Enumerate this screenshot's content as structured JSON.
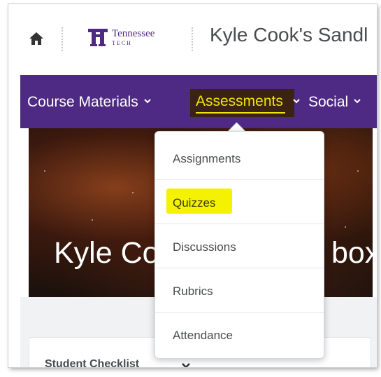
{
  "header": {
    "logo": {
      "word": "Tennessee",
      "sub": "TECH"
    },
    "course_title": "Kyle Cook's Sandl"
  },
  "nav": {
    "items": [
      {
        "label": "Course Materials"
      },
      {
        "label": "Assessments",
        "active": true
      },
      {
        "label": "Social"
      }
    ]
  },
  "banner": {
    "title_left": "Kyle Co",
    "title_right": "box"
  },
  "dropdown": {
    "items": [
      {
        "label": "Assignments"
      },
      {
        "label": "Quizzes",
        "highlighted": true
      },
      {
        "label": "Discussions"
      },
      {
        "label": "Rubrics"
      },
      {
        "label": "Attendance"
      }
    ]
  },
  "checklist": {
    "title": "Student Checklist"
  },
  "colors": {
    "brand_purple": "#4e2a84",
    "active_yellow": "#f0e600",
    "highlight_yellow": "#f5f200",
    "text_gray": "#494c4e"
  }
}
